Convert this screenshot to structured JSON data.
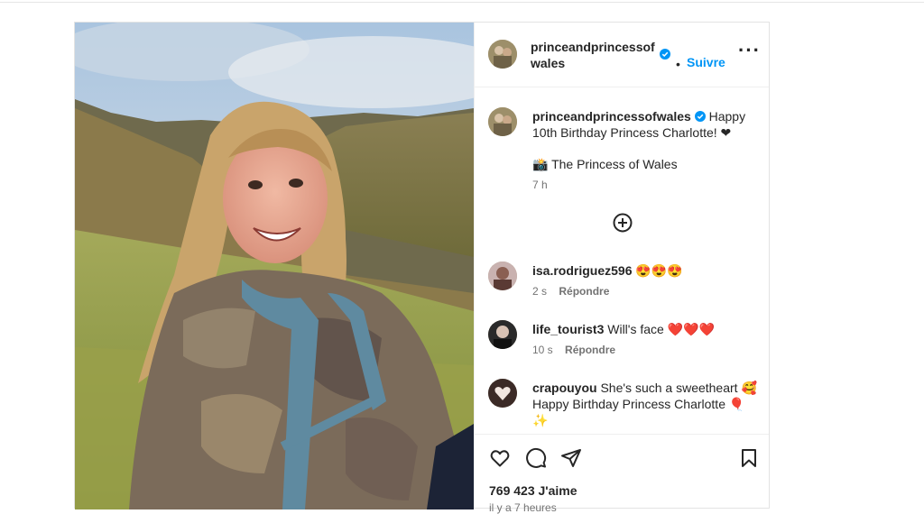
{
  "post": {
    "username": "princeandprincessofwales",
    "username_wrapped_1": "princeandprincessof",
    "username_wrapped_2": "wales",
    "follow_label": "Suivre",
    "dot": "•",
    "more_label": "···"
  },
  "caption": {
    "username": "princeandprincessofwales",
    "text": " Happy 10th Birthday Princess Charlotte! ❤",
    "credit": "📸 The Princess of Wales",
    "time": "7 h"
  },
  "comments": [
    {
      "username": "isa.rodriguez596",
      "text": " 😍😍😍",
      "time": "2 s",
      "reply": "Répondre"
    },
    {
      "username": "life_tourist3",
      "text": " Will's face ❤️❤️❤️",
      "time": "10 s",
      "reply": "Répondre"
    },
    {
      "username": "crapouyou",
      "text": " She's such a sweetheart 🥰 Happy Birthday Princess Charlotte 🎈✨",
      "time": "",
      "reply": ""
    }
  ],
  "footer": {
    "likes": "769 423 J'aime",
    "date": "il y a 7 heures"
  },
  "icons": {
    "verified": "verified-badge-icon",
    "like": "heart-icon",
    "comment": "comment-bubble-icon",
    "share": "paper-plane-icon",
    "save": "bookmark-icon",
    "add": "plus-circle-icon"
  },
  "colors": {
    "accent": "#0095f6",
    "verified": "#0095f6",
    "text": "#262626",
    "muted": "#737373"
  }
}
